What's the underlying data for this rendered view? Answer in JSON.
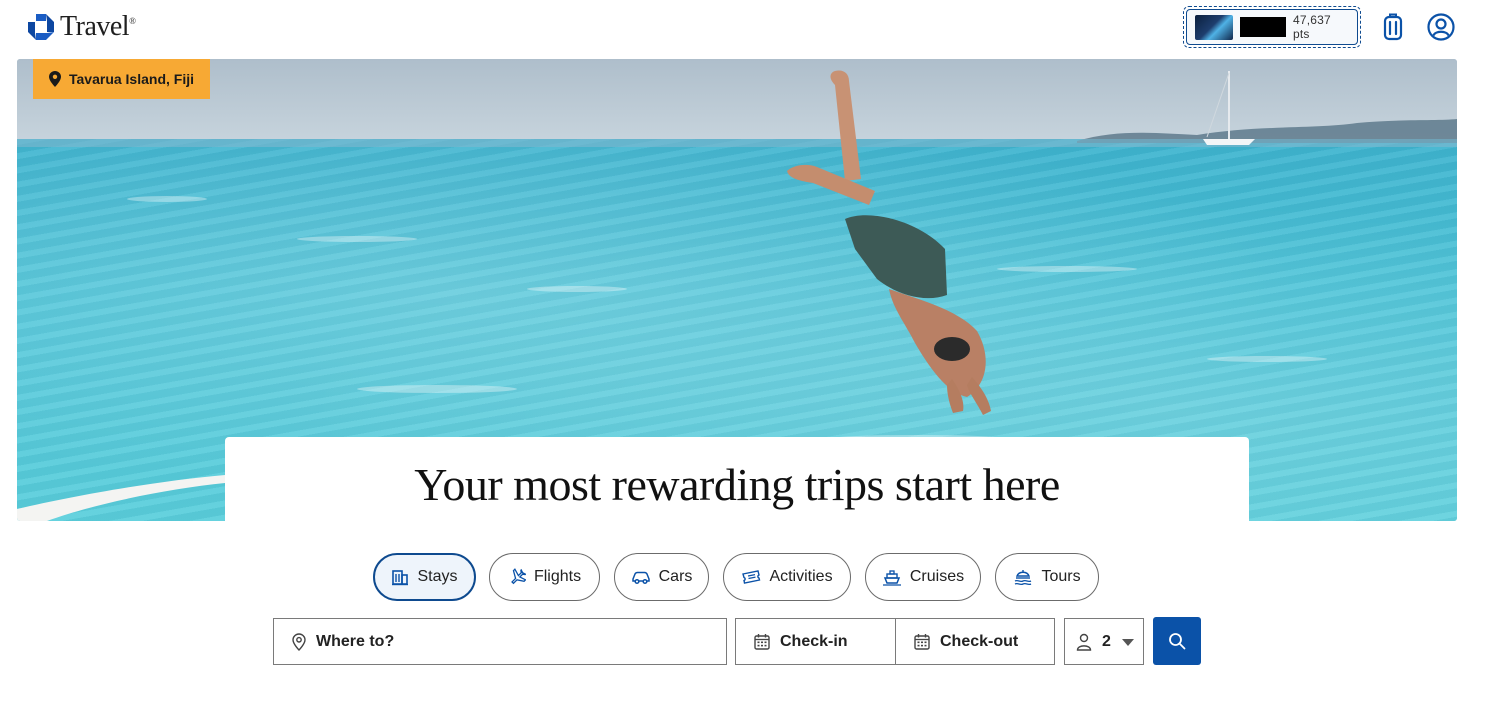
{
  "header": {
    "brand_name": "Travel",
    "brand_tm": "®",
    "rewards_points": "47,637 pts",
    "icons": {
      "logo": "chase-octagon-logo",
      "trips": "luggage-icon",
      "account": "user-circle-icon"
    }
  },
  "hero": {
    "location_label": "Tavarua Island, Fiji",
    "headline": "Your most rewarding trips start here"
  },
  "tabs": [
    {
      "label": "Stays",
      "icon": "building-icon",
      "active": true
    },
    {
      "label": "Flights",
      "icon": "plane-icon",
      "active": false
    },
    {
      "label": "Cars",
      "icon": "car-icon",
      "active": false
    },
    {
      "label": "Activities",
      "icon": "ticket-icon",
      "active": false
    },
    {
      "label": "Cruises",
      "icon": "ship-icon",
      "active": false
    },
    {
      "label": "Tours",
      "icon": "tour-icon",
      "active": false
    }
  ],
  "search": {
    "destination_placeholder": "Where to?",
    "checkin_label": "Check-in",
    "checkout_label": "Check-out",
    "guests_value": "2"
  },
  "colors": {
    "brand_blue": "#0b52a8",
    "accent_orange": "#f7a934",
    "active_tab_border": "#0e4a8f"
  }
}
